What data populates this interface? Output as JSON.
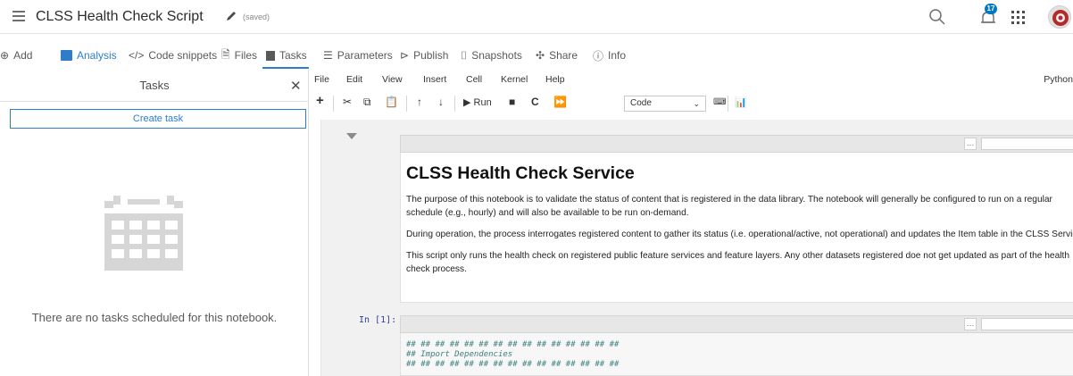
{
  "header": {
    "title": "CLSS Health Check Script",
    "saved_label": "(saved)",
    "notification_count": "17"
  },
  "toolbar": {
    "items": [
      {
        "label": "Add",
        "icon": "plus-circle-icon"
      },
      {
        "label": "Analysis",
        "icon": "analysis-icon"
      },
      {
        "label": "Code snippets",
        "icon": "code-icon"
      },
      {
        "label": "Files",
        "icon": "file-icon"
      },
      {
        "label": "Tasks",
        "icon": "calendar-icon"
      },
      {
        "label": "Parameters",
        "icon": "parameters-icon"
      },
      {
        "label": "Publish",
        "icon": "publish-icon"
      },
      {
        "label": "Snapshots",
        "icon": "snapshot-icon"
      },
      {
        "label": "Share",
        "icon": "share-icon"
      },
      {
        "label": "Info",
        "icon": "info-icon"
      }
    ],
    "active": "Tasks"
  },
  "tasks_panel": {
    "title": "Tasks",
    "create_label": "Create task",
    "empty_message": "There are no tasks scheduled for this notebook."
  },
  "notebook": {
    "menu": [
      "File",
      "Edit",
      "View",
      "Insert",
      "Cell",
      "Kernel",
      "Help"
    ],
    "kernel": "Python",
    "run_label": "Run",
    "cell_type": "Code",
    "markdown": {
      "heading": "CLSS Health Check Service",
      "p1": "The purpose of this notebook is to validate the status of content that is registered in the data library. The notebook will generally be configured to run on a regular schedule (e.g., hourly) and will also be available to be run on-demand.",
      "p2": "During operation, the process interrogates registered content to gather its status (i.e. operational/active, not operational) and updates the Item table in the CLSS Service.",
      "p3": "This script only runs the health check on registered public feature services and feature layers. Any other datasets registered doe not get updated as part of the health check process."
    },
    "code_cell": {
      "prompt": "In [1]:",
      "lines": [
        "## ## ## ## ## ## ## ## ## ## ## ## ## ## ##",
        "## Import Dependencies",
        "## ## ## ## ## ## ## ## ## ## ## ## ## ## ##"
      ]
    }
  },
  "colors": {
    "accent": "#2f7cc9",
    "badge": "#0079c1"
  }
}
